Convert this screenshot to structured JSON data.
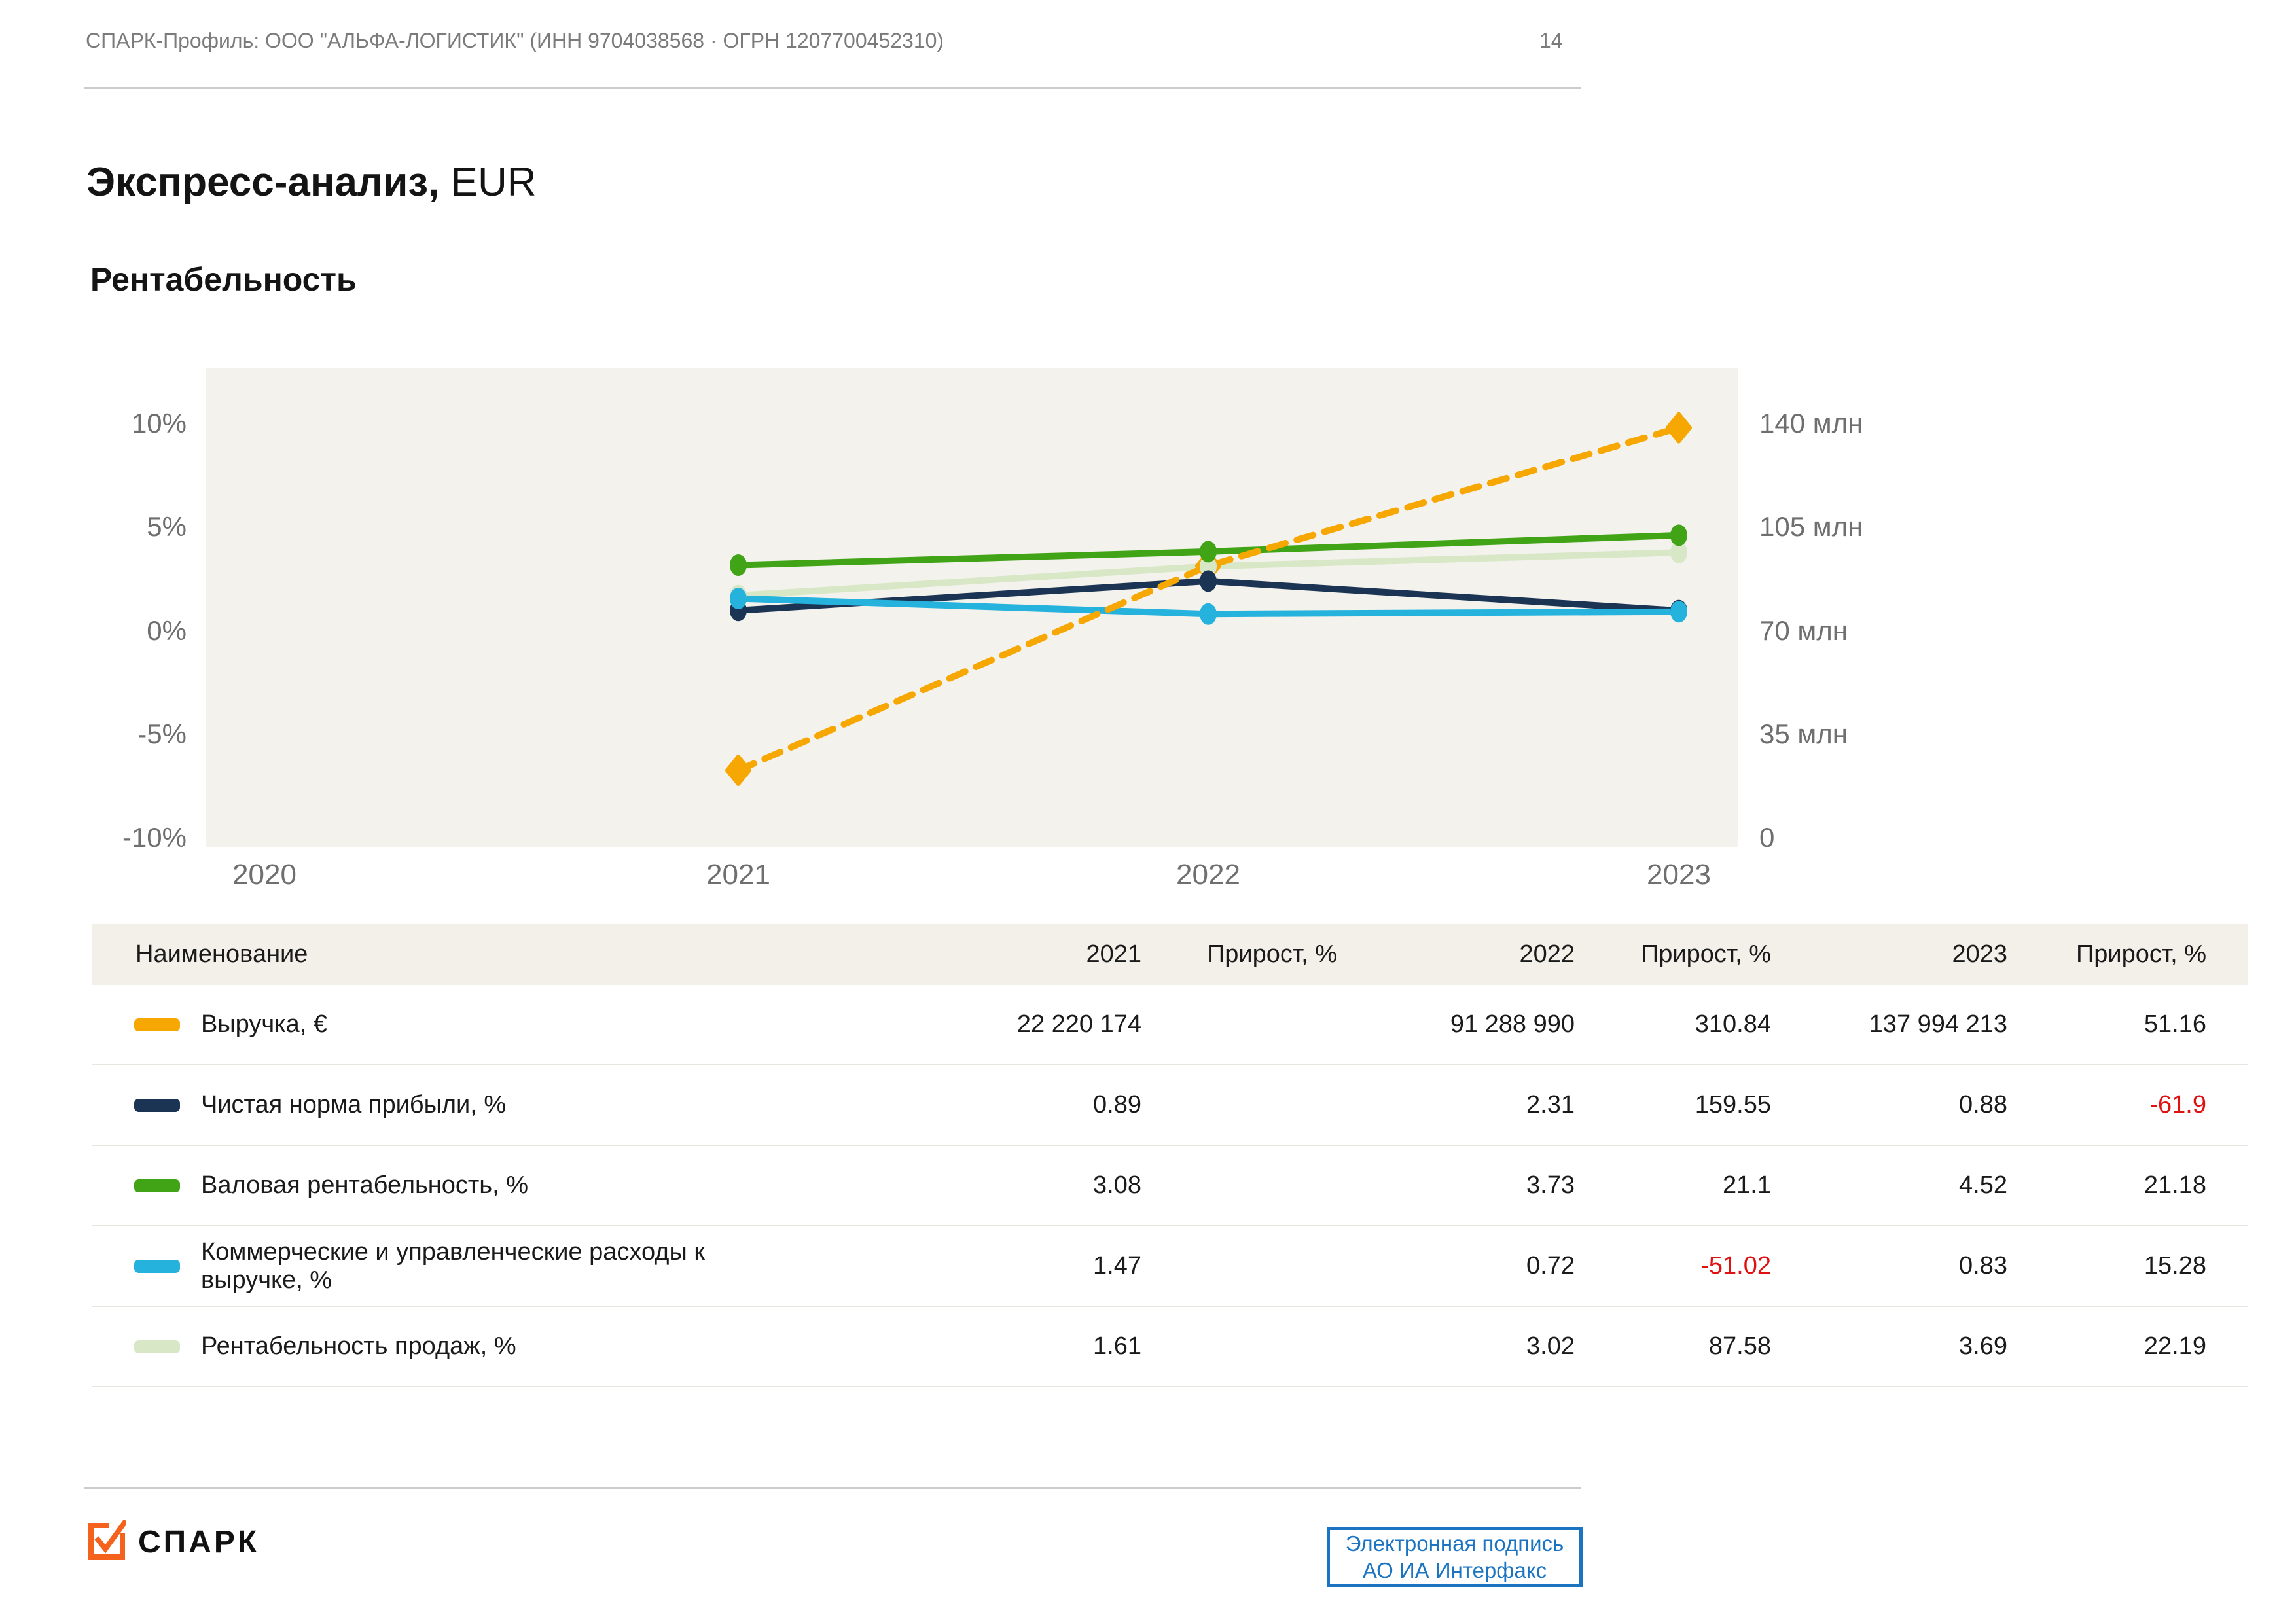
{
  "header": {
    "profile": "СПАРК-Профиль: ООО \"АЛЬФА-ЛОГИСТИК\" (ИНН 9704038568 · ОГРН 1207700452310)",
    "page_number": "14"
  },
  "title": {
    "main": "Экспресс-анализ,",
    "currency": " EUR"
  },
  "section_title": "Рентабельность",
  "colors": {
    "revenue_orange": "#F7A702",
    "net_margin_navy": "#1B3453",
    "gross_margin_green": "#41A417",
    "expenses_cyan": "#25B2DC",
    "ros_light_green": "#D8E7C6",
    "negative_red": "#E01111",
    "chart_background": "#F4F2EC",
    "table_header_background": "#F2F0E9",
    "signature_blue": "#1B74C2",
    "logo_orange": "#F5621D"
  },
  "chart_data": {
    "type": "line",
    "x_ticks": [
      "2020",
      "2021",
      "2022",
      "2023"
    ],
    "left_axis": {
      "ticks": [
        "10%",
        "5%",
        "0%",
        "-5%",
        "-10%"
      ],
      "min": -10,
      "max": 10
    },
    "right_axis": {
      "ticks": [
        "140 млн",
        "105 млн",
        "70 млн",
        "35 млн",
        "0"
      ],
      "min": 0,
      "max": 140000000
    },
    "grid": "off",
    "legend_position": "in-table-below",
    "series": [
      {
        "name": "Выручка, €",
        "axis": "right",
        "color": "#F7A702",
        "style": "dashed",
        "marker": "diamond",
        "values": {
          "2021": 22220174,
          "2022": 91288990,
          "2023": 137994213
        }
      },
      {
        "name": "Чистая норма прибыли, %",
        "axis": "left",
        "color": "#1B3453",
        "style": "solid",
        "marker": "ellipse",
        "values": {
          "2021": 0.89,
          "2022": 2.31,
          "2023": 0.88
        }
      },
      {
        "name": "Валовая рентабельность, %",
        "axis": "left",
        "color": "#41A417",
        "style": "solid",
        "marker": "ellipse",
        "values": {
          "2021": 3.08,
          "2022": 3.73,
          "2023": 4.52
        }
      },
      {
        "name": "Коммерческие и управленческие расходы к выручке, %",
        "axis": "left",
        "color": "#25B2DC",
        "style": "solid",
        "marker": "ellipse",
        "values": {
          "2021": 1.47,
          "2022": 0.72,
          "2023": 0.83
        }
      },
      {
        "name": "Рентабельность продаж, %",
        "axis": "left",
        "color": "#D8E7C6",
        "style": "solid",
        "marker": "ellipse",
        "values": {
          "2021": 1.61,
          "2022": 3.02,
          "2023": 3.69
        }
      }
    ]
  },
  "table": {
    "columns": [
      "Наименование",
      "2021",
      "Прирост, %",
      "2022",
      "Прирост, %",
      "2023",
      "Прирост, %"
    ],
    "rows": [
      {
        "name": "Выручка, €",
        "swatch": "#F7A702",
        "values": [
          "22 220 174",
          "",
          "91 288 990",
          "310.84",
          "137 994 213",
          "51.16"
        ]
      },
      {
        "name": "Чистая норма прибыли, %",
        "swatch": "#1B3453",
        "values": [
          "0.89",
          "",
          "2.31",
          "159.55",
          "0.88",
          "-61.9"
        ]
      },
      {
        "name": "Валовая рентабельность, %",
        "swatch": "#41A417",
        "values": [
          "3.08",
          "",
          "3.73",
          "21.1",
          "4.52",
          "21.18"
        ]
      },
      {
        "name": "Коммерческие и управленческие расходы к выручке, %",
        "swatch": "#25B2DC",
        "values": [
          "1.47",
          "",
          "0.72",
          "-51.02",
          "0.83",
          "15.28"
        ]
      },
      {
        "name": "Рентабельность продаж, %",
        "swatch": "#D8E7C6",
        "values": [
          "1.61",
          "",
          "3.02",
          "87.58",
          "3.69",
          "22.19"
        ]
      }
    ]
  },
  "footer": {
    "logo_text": "СПАРК",
    "signature_button": {
      "line1": "Электронная подпись",
      "line2": "АО ИА Интерфакс"
    }
  }
}
